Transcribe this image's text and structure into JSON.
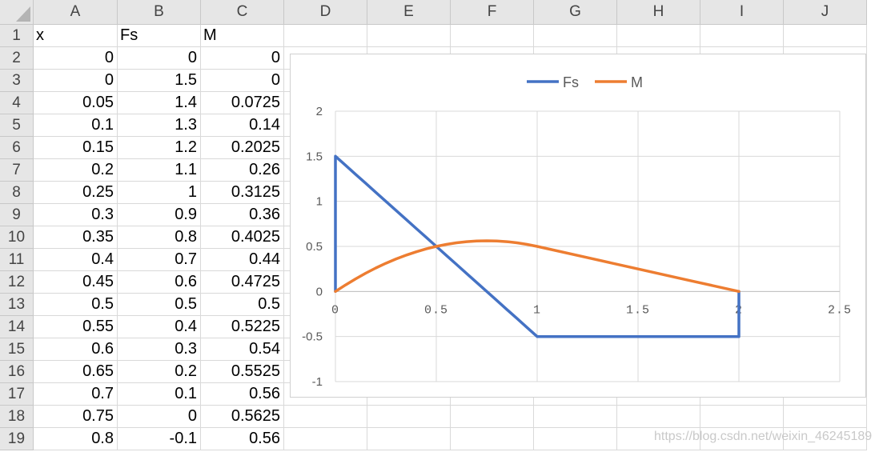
{
  "columns": [
    "A",
    "B",
    "C",
    "D",
    "E",
    "F",
    "G",
    "H",
    "I",
    "J"
  ],
  "row_numbers": [
    "1",
    "2",
    "3",
    "4",
    "5",
    "6",
    "7",
    "8",
    "9",
    "10",
    "11",
    "12",
    "13",
    "14",
    "15",
    "16",
    "17",
    "18",
    "19"
  ],
  "header_row": [
    "x",
    "Fs",
    "M"
  ],
  "data_rows": [
    [
      "0",
      "0",
      "0"
    ],
    [
      "0",
      "1.5",
      "0"
    ],
    [
      "0.05",
      "1.4",
      "0.0725"
    ],
    [
      "0.1",
      "1.3",
      "0.14"
    ],
    [
      "0.15",
      "1.2",
      "0.2025"
    ],
    [
      "0.2",
      "1.1",
      "0.26"
    ],
    [
      "0.25",
      "1",
      "0.3125"
    ],
    [
      "0.3",
      "0.9",
      "0.36"
    ],
    [
      "0.35",
      "0.8",
      "0.4025"
    ],
    [
      "0.4",
      "0.7",
      "0.44"
    ],
    [
      "0.45",
      "0.6",
      "0.4725"
    ],
    [
      "0.5",
      "0.5",
      "0.5"
    ],
    [
      "0.55",
      "0.4",
      "0.5225"
    ],
    [
      "0.6",
      "0.3",
      "0.54"
    ],
    [
      "0.65",
      "0.2",
      "0.5525"
    ],
    [
      "0.7",
      "0.1",
      "0.56"
    ],
    [
      "0.75",
      "0",
      "0.5625"
    ],
    [
      "0.8",
      "-0.1",
      "0.56"
    ]
  ],
  "watermark": "https://blog.csdn.net/weixin_46245189",
  "chart_data": {
    "type": "scatter",
    "title": "",
    "xlabel": "",
    "ylabel": "",
    "xlim": [
      0,
      2.5
    ],
    "ylim": [
      -1,
      2
    ],
    "x_ticks": [
      "0",
      "0.5",
      "1",
      "1.5",
      "2",
      "2.5"
    ],
    "y_ticks": [
      "2",
      "1.5",
      "1",
      "0.5",
      "0",
      "-0.5",
      "-1"
    ],
    "grid": true,
    "legend_position": "top",
    "series": [
      {
        "name": "Fs",
        "color": "#4472c4",
        "x": [
          0,
          0,
          0.05,
          0.1,
          0.15,
          0.2,
          0.25,
          0.3,
          0.35,
          0.4,
          0.45,
          0.5,
          0.55,
          0.6,
          0.65,
          0.7,
          0.75,
          0.8,
          0.85,
          0.9,
          0.95,
          1,
          1.5,
          2,
          2
        ],
        "y": [
          0,
          1.5,
          1.4,
          1.3,
          1.2,
          1.1,
          1,
          0.9,
          0.8,
          0.7,
          0.6,
          0.5,
          0.4,
          0.3,
          0.2,
          0.1,
          0,
          -0.1,
          -0.2,
          -0.3,
          -0.4,
          -0.5,
          -0.5,
          -0.5,
          0
        ]
      },
      {
        "name": "M",
        "color": "#ed7d31",
        "x": [
          0,
          0.05,
          0.1,
          0.15,
          0.2,
          0.25,
          0.3,
          0.35,
          0.4,
          0.45,
          0.5,
          0.55,
          0.6,
          0.65,
          0.7,
          0.75,
          0.8,
          0.85,
          0.9,
          0.95,
          1,
          1.25,
          1.5,
          1.75,
          2
        ],
        "y": [
          0,
          0.0725,
          0.14,
          0.2025,
          0.26,
          0.3125,
          0.36,
          0.4025,
          0.44,
          0.4725,
          0.5,
          0.5225,
          0.54,
          0.5525,
          0.56,
          0.5625,
          0.56,
          0.5525,
          0.54,
          0.5225,
          0.5,
          0.375,
          0.25,
          0.125,
          0
        ]
      }
    ]
  }
}
